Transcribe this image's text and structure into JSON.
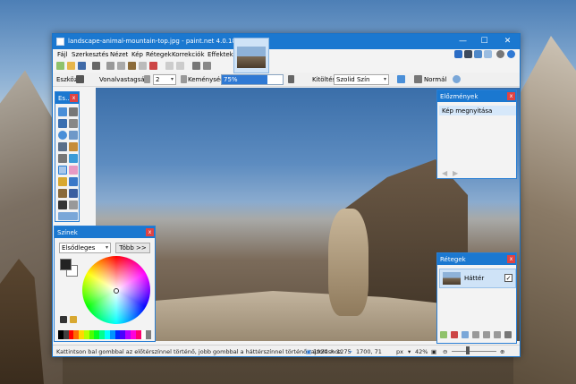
{
  "window": {
    "title": "landscape-animal-mountain-top.jpg - paint.net 4.0.18",
    "minimize_glyph": "—",
    "maximize_glyph": "☐",
    "close_glyph": "✕"
  },
  "image_tab": {
    "arrow": "▾"
  },
  "menu": {
    "items": [
      "Fájl",
      "Szerkesztés",
      "Nézet",
      "Kép",
      "Rétegek",
      "Korrekciók",
      "Effektek"
    ]
  },
  "toolbar": {
    "tool_label": "Eszköz:",
    "width_label": "Vonalvastagság:",
    "width_value": "2",
    "hardness_label": "Keménység:",
    "hardness_value": "75%",
    "hardness_fraction": 0.75,
    "fill_label": "Kitöltés:",
    "fill_value": "Szolid Szín",
    "blend_value": "Normál"
  },
  "tools_panel": {
    "title": "Es...",
    "close_glyph": "x"
  },
  "colors_panel": {
    "title": "Színek",
    "close_glyph": "x",
    "mode_value": "Elsődleges",
    "more_button": "Több >>",
    "primary_color": "#222222",
    "secondary_color": "#ffffff",
    "palette": [
      "#000000",
      "#404040",
      "#ff0000",
      "#ff6a00",
      "#ffd800",
      "#b6ff00",
      "#4cff00",
      "#00ff21",
      "#00ff90",
      "#00ffff",
      "#0094ff",
      "#0026ff",
      "#4800ff",
      "#b200ff",
      "#ff00dc",
      "#ff006e",
      "#ffffff",
      "#808080"
    ]
  },
  "history_panel": {
    "title": "Előzmények",
    "close_glyph": "x",
    "items": [
      "Kép megnyitása"
    ],
    "undo_glyph": "◀",
    "redo_glyph": "▶"
  },
  "layers_panel": {
    "title": "Rétegek",
    "close_glyph": "x",
    "layers": [
      {
        "name": "Háttér",
        "visible_glyph": "✓"
      }
    ]
  },
  "statusbar": {
    "hint": "Kattintson bal gombbal az előtérszínnel történő, jobb gombbal a háttérszínnel történő rajzoláshoz.",
    "image_size": "1920 × 1275",
    "cursor_pos": "1700, 71",
    "units": "px",
    "zoom": "42%"
  }
}
